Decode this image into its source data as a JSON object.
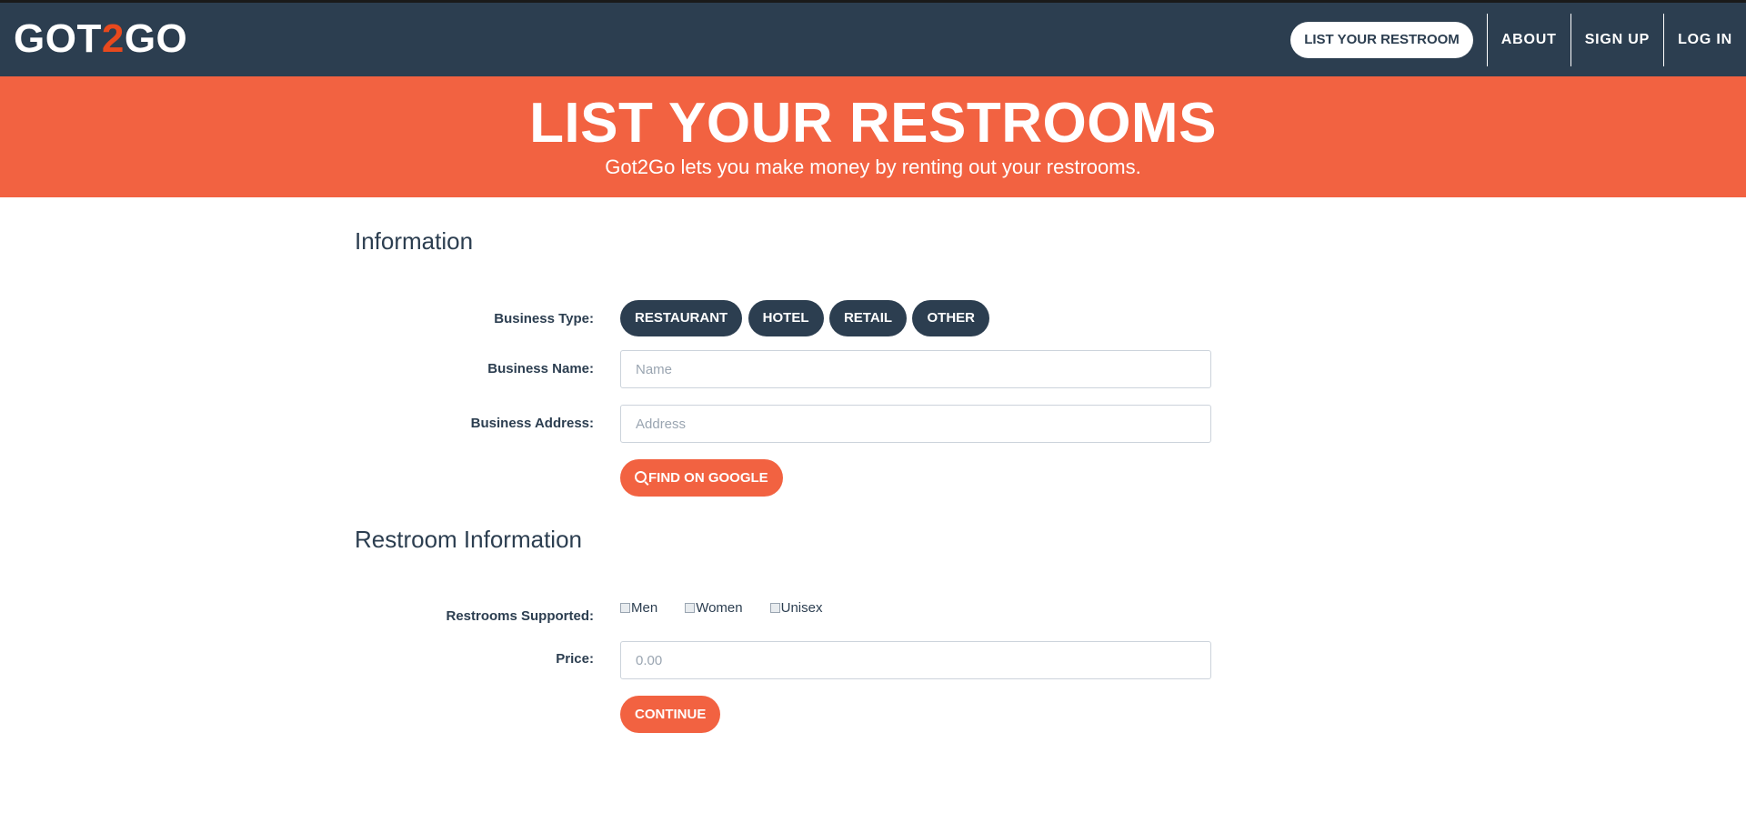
{
  "header": {
    "logo_pre": "GOT",
    "logo_accent": "2",
    "logo_post": "GO",
    "nav": {
      "list_restroom": "LIST YOUR RESTROOM",
      "about": "ABOUT",
      "sign_up": "SIGN UP",
      "log_in": "LOG IN"
    }
  },
  "hero": {
    "title": "LIST YOUR RESTROOMS",
    "subtitle": "Got2Go lets you make money by renting out your restrooms."
  },
  "information": {
    "section_title": "Information",
    "business_type_label": "Business Type:",
    "business_types": [
      "RESTAURANT",
      "HOTEL",
      "RETAIL",
      "OTHER"
    ],
    "business_name_label": "Business Name:",
    "business_name_placeholder": "Name",
    "business_address_label": "Business Address:",
    "business_address_placeholder": "Address",
    "find_on_google_label": "FIND ON GOOGLE"
  },
  "restroom": {
    "section_title": "Restroom Information",
    "supported_label": "Restrooms Supported:",
    "options": [
      "Men",
      "Women",
      "Unisex"
    ],
    "price_label": "Price:",
    "price_placeholder": "0.00",
    "continue_label": "CONTINUE"
  },
  "colors": {
    "navy": "#2c3e50",
    "orange": "#f26241",
    "logo_accent": "#e8491d"
  }
}
